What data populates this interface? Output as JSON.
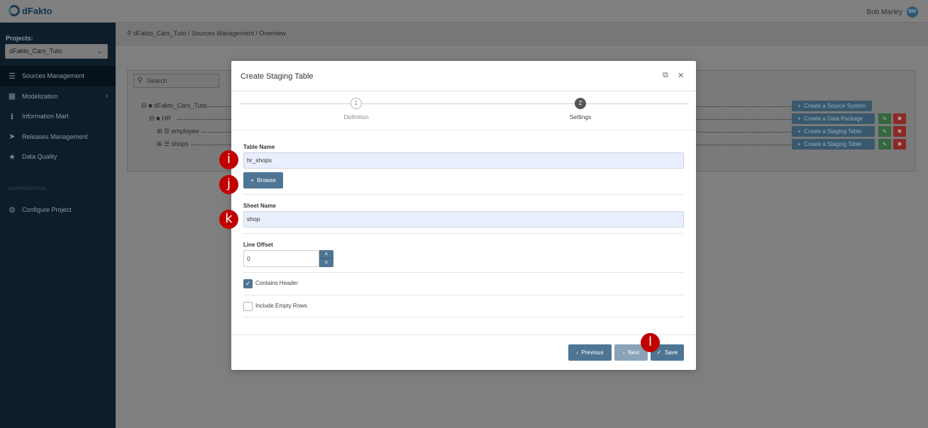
{
  "app": {
    "logo_text": "dFakto",
    "user_name": "Bob Marley",
    "user_initials": "BM"
  },
  "sidebar": {
    "projects_label": "Projects:",
    "project_selected": "dFakto_Cars_Tuto",
    "items": [
      {
        "label": "Sources Management",
        "icon": "layers-icon"
      },
      {
        "label": "Modelization",
        "icon": "sitemap-icon"
      },
      {
        "label": "Information Mart",
        "icon": "info-icon"
      },
      {
        "label": "Releases Management",
        "icon": "rocket-icon"
      },
      {
        "label": "Data Quality",
        "icon": "star-icon"
      }
    ],
    "section_label": "CONFIGURATION",
    "config_item": "Configure Project"
  },
  "breadcrumb": "dFakto_Cars_Tuto  /  Sources Management  /  Overview",
  "panel": {
    "search_placeholder": "Search",
    "tree": [
      {
        "label": "dFakto_Cars_Tuto",
        "action": "Create a Source System"
      },
      {
        "label": "HR",
        "action": "Create a Data Package"
      },
      {
        "label": "employee",
        "action": "Create a Staging Table"
      },
      {
        "label": "shops",
        "action": "Create a Staging Table"
      }
    ]
  },
  "modal": {
    "title": "Create Staging Table",
    "steps": [
      {
        "number": "1",
        "label": "Definition"
      },
      {
        "number": "2",
        "label": "Settings"
      }
    ],
    "table_name_label": "Table Name",
    "table_name_value": "hr_shops",
    "browse_label": "Browse",
    "sheet_name_label": "Sheet Name",
    "sheet_name_value": "shop",
    "line_offset_label": "Line Offset",
    "line_offset_value": "0",
    "contains_header_label": "Contains Header",
    "contains_header_checked": true,
    "include_empty_rows_label": "Include Empty Rows",
    "include_empty_rows_checked": false,
    "previous_label": "Previous",
    "next_label": "Next",
    "save_label": "Save"
  },
  "markers": [
    "i",
    "j",
    "k",
    "l"
  ],
  "colors": {
    "primary": "#4f7594",
    "marker": "#c00000",
    "sidebar": "#0e1d2a"
  }
}
